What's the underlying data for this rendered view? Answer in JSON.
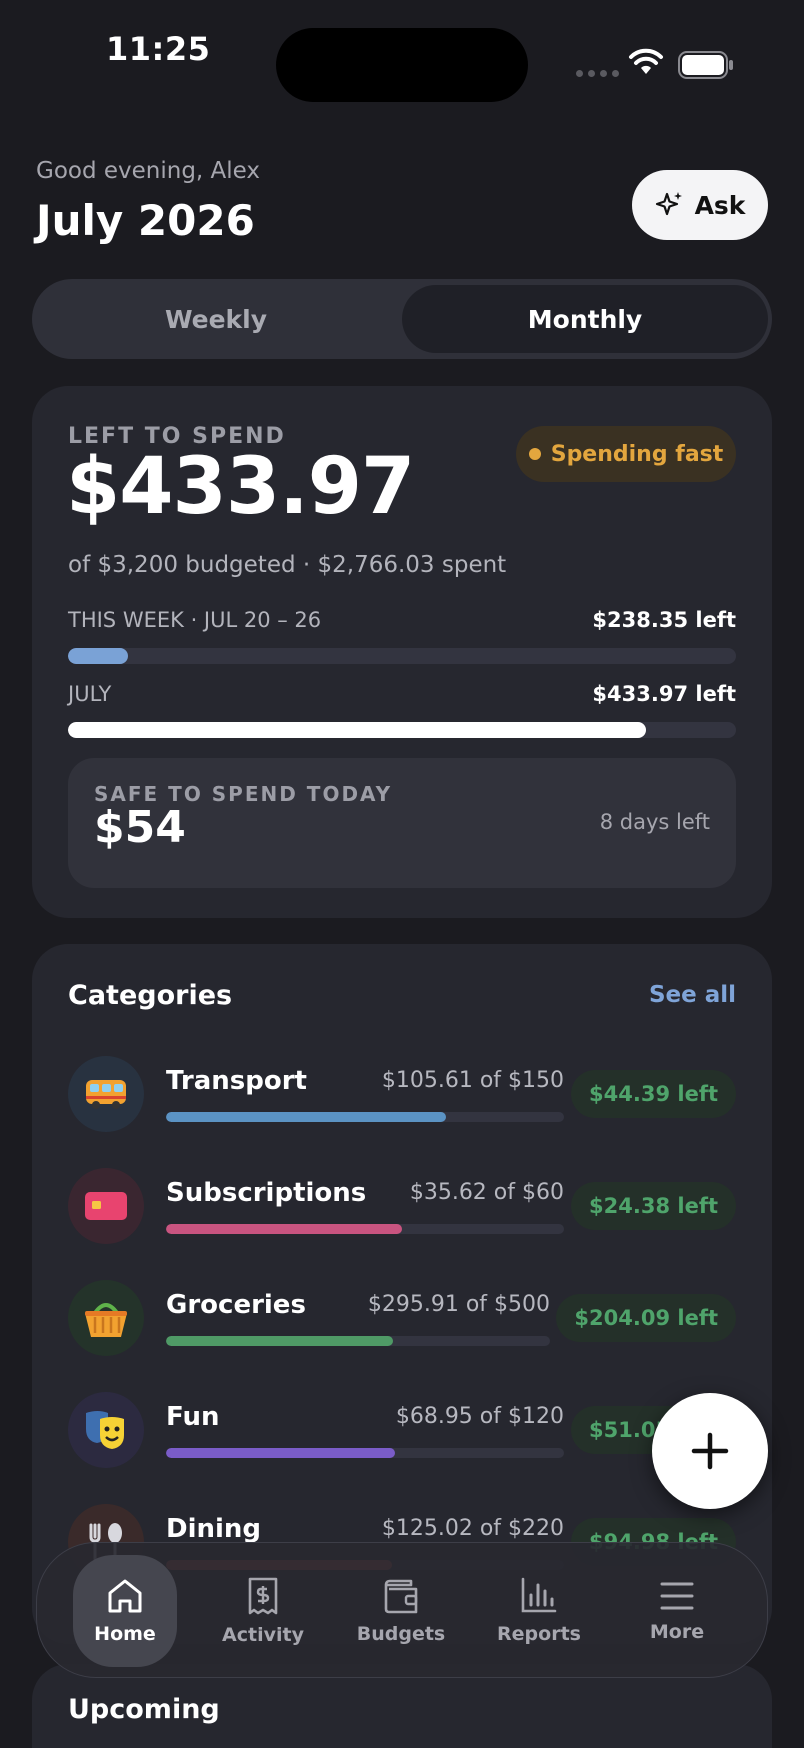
{
  "status_bar": {
    "time": "11:25"
  },
  "header": {
    "greeting": "Good evening, Alex",
    "title": "July 2026",
    "ask_label": "Ask"
  },
  "segmented": {
    "weekly": "Weekly",
    "monthly": "Monthly",
    "selected": "Monthly"
  },
  "summary": {
    "left_label": "LEFT TO SPEND",
    "left_amount": "$433.97",
    "badge": "Spending fast",
    "budget_line": "of $3,200 budgeted · $2,766.03 spent",
    "week_label": "THIS WEEK · JUL 20 – 26",
    "week_left": "$238.35 left",
    "week_progress": 0.09,
    "month_label": "JULY",
    "month_left": "$433.97 left",
    "month_progress": 0.865,
    "safe_label": "SAFE TO SPEND TODAY",
    "safe_amount": "$54",
    "days_left": "8 days left"
  },
  "categories": {
    "title": "Categories",
    "see_all": "See all",
    "items": [
      {
        "name": "Transport",
        "amount": "$105.61 of $150",
        "left": "$44.39 left",
        "progress": 0.704,
        "color": "#5b93c4",
        "icon": "bus-icon",
        "icon_bg": "#283240"
      },
      {
        "name": "Subscriptions",
        "amount": "$35.62 of $60",
        "left": "$24.38 left",
        "progress": 0.594,
        "color": "#c95480",
        "icon": "card-icon",
        "icon_bg": "#3a2630"
      },
      {
        "name": "Groceries",
        "amount": "$295.91 of $500",
        "left": "$204.09 left",
        "progress": 0.592,
        "color": "#4f9a66",
        "icon": "basket-icon",
        "icon_bg": "#24332a"
      },
      {
        "name": "Fun",
        "amount": "$68.95 of $120",
        "left": "$51.05 left",
        "progress": 0.575,
        "color": "#7a5cc8",
        "icon": "masks-icon",
        "icon_bg": "#2c2a40"
      },
      {
        "name": "Dining",
        "amount": "$125.02 of $220",
        "left": "$94.98 left",
        "progress": 0.568,
        "color": "#c9604a",
        "icon": "utensils-icon",
        "icon_bg": "#3a2a2a"
      }
    ]
  },
  "upcoming": {
    "title": "Upcoming"
  },
  "tabs": [
    {
      "label": "Home",
      "icon": "home-icon"
    },
    {
      "label": "Activity",
      "icon": "receipt-icon"
    },
    {
      "label": "Budgets",
      "icon": "wallet-icon"
    },
    {
      "label": "Reports",
      "icon": "bar-chart-icon"
    },
    {
      "label": "More",
      "icon": "menu-icon"
    }
  ],
  "colors": {
    "accent": "#7fa4d8",
    "warning": "#e3a63e",
    "positive": "#4fa46b"
  }
}
